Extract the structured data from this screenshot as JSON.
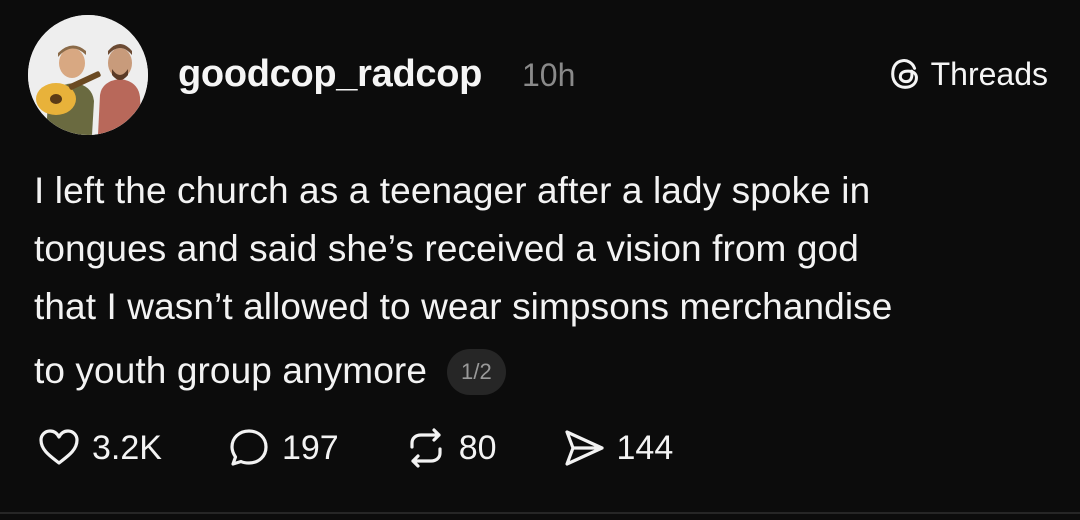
{
  "post": {
    "username": "goodcop_radcop",
    "timestamp": "10h",
    "brand_label": "Threads",
    "lines": [
      "I left the church as a teenager after a lady spoke in",
      "tongues and said she’s received a vision from god",
      "that I wasn’t allowed to wear simpsons merchandise",
      "to youth group anymore"
    ],
    "page_indicator": "1/2"
  },
  "actions": {
    "likes": "3.2K",
    "replies": "197",
    "reposts": "80",
    "shares": "144"
  },
  "icons": {
    "brand": "threads-logo-icon",
    "like": "heart-icon",
    "reply": "comment-bubble-icon",
    "repost": "repost-arrows-icon",
    "share": "send-icon"
  },
  "colors": {
    "background": "#0c0c0c",
    "text": "#f3f3f3",
    "muted": "#8a8a8a",
    "badge_bg": "#262626"
  }
}
